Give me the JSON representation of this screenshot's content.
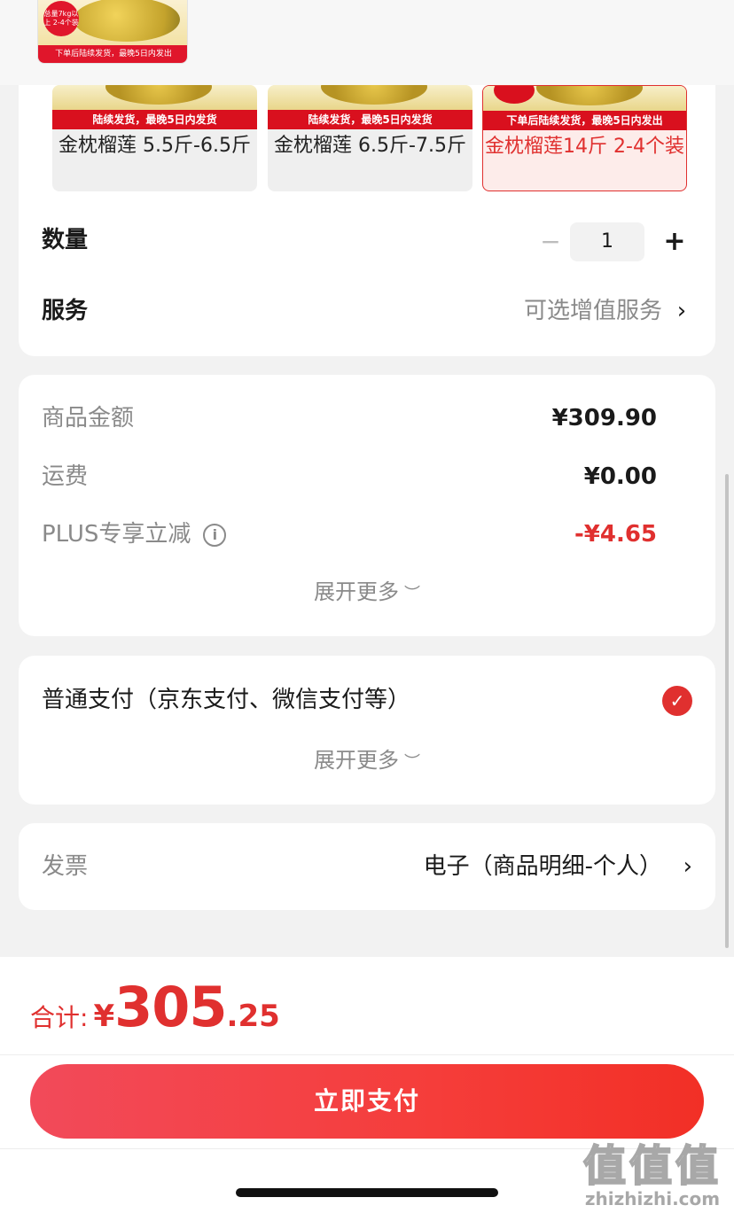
{
  "thumbnail": {
    "badge": "总量7kg以上 2-4个装",
    "strip": "下单后陆续发货，最晚5日内发出"
  },
  "skus": [
    {
      "banner": "陆续发货，最晚5日内发货",
      "title": "金枕榴莲 5.5斤-6.5斤",
      "selected": false
    },
    {
      "banner": "陆续发货，最晚5日内发货",
      "title": "金枕榴莲 6.5斤-7.5斤",
      "selected": false
    },
    {
      "banner": "下单后陆续发货，最晚5日内发出",
      "title": "金枕榴莲14斤 2-4个装",
      "selected": true
    }
  ],
  "quantity": {
    "label": "数量",
    "minus": "−",
    "value": "1",
    "plus": "+"
  },
  "service": {
    "label": "服务",
    "value": "可选增值服务"
  },
  "price": {
    "rows": [
      {
        "label": "商品金额",
        "value": "¥309.90"
      },
      {
        "label": "运费",
        "value": "¥0.00"
      },
      {
        "label": "PLUS专享立减",
        "value": "-¥4.65"
      }
    ],
    "expand": "展开更多"
  },
  "payment": {
    "label": "普通支付（京东支付、微信支付等）",
    "expand": "展开更多"
  },
  "invoice": {
    "label": "发票",
    "value": "电子（商品明细-个人）"
  },
  "total": {
    "label": "合计:",
    "currency": "¥",
    "integer": "305",
    "decimal": ".25"
  },
  "pay_button": "立即支付",
  "watermark": {
    "big": "值值值",
    "small": "zhizhizhi.com"
  },
  "colors": {
    "accent": "#e0302f",
    "banner": "#d9101e"
  }
}
